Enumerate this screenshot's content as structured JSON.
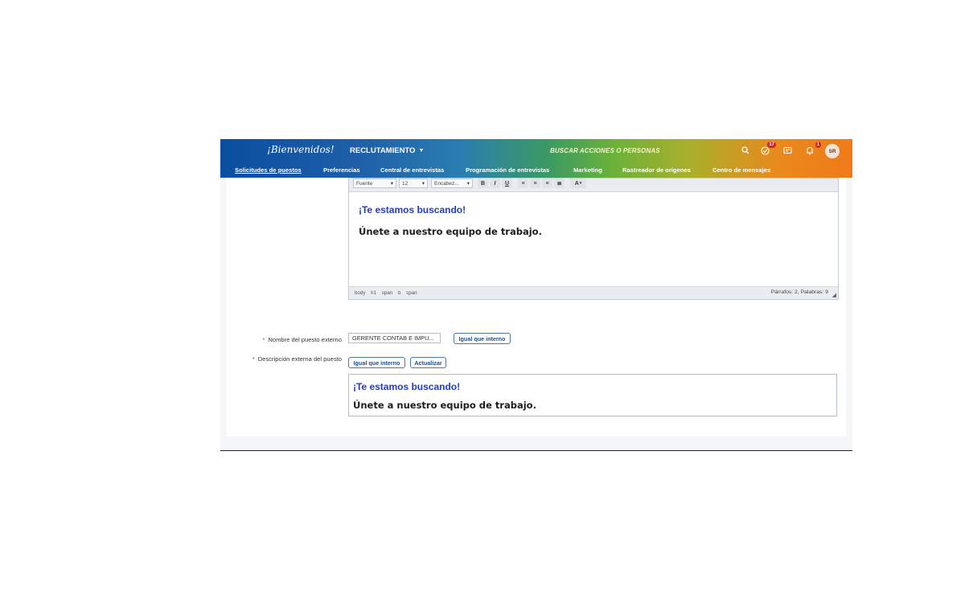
{
  "header": {
    "logo_text": "¡Bienvenidos!",
    "module_label": "RECLUTAMIENTO",
    "search_placeholder": "BUSCAR ACCIONES O PERSONAS",
    "todo_badge": "17",
    "notification_badge": "1",
    "avatar_initials": "SR",
    "icons": [
      "search-icon",
      "todo-icon",
      "apps-icon",
      "bell-icon"
    ]
  },
  "nav": {
    "items": [
      {
        "label": "Solicitudes de puestos",
        "active": true
      },
      {
        "label": "Preferencias"
      },
      {
        "label": "Central de entrevistas"
      },
      {
        "label": "Programación de entrevistas"
      },
      {
        "label": "Marketing"
      },
      {
        "label": "Rastreador de orígenes"
      },
      {
        "label": "Centro de mensajes"
      }
    ]
  },
  "editor": {
    "font_select": "Fuente",
    "size_select": "12",
    "heading_select": "Encabez...",
    "buttons": [
      "B",
      "I",
      "U",
      "≡",
      "≡",
      "≡",
      "≣",
      "A"
    ],
    "heading": "¡Te estamos buscando!",
    "body": "Únete a nuestro equipo de trabajo.",
    "path": [
      "body",
      "h1",
      "span",
      "b",
      "span"
    ],
    "word_count": "Párrafos: 2, Palabras: 9"
  },
  "form": {
    "name_label": "Nombre del puesto externo",
    "name_value": "GERENTE CONTAB E IMPU...",
    "same_as_internal_label": "Igual que interno",
    "description_label": "Descripción externa del puesto",
    "update_label": "Actualizar"
  },
  "preview": {
    "heading": "¡Te estamos buscando!",
    "body": "Únete a nuestro equipo de trabajo."
  }
}
